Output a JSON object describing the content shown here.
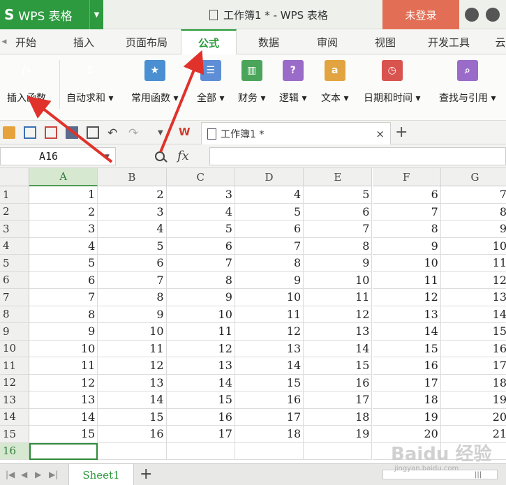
{
  "titlebar": {
    "app_logo": "S",
    "app_name": "WPS 表格",
    "doc_title": "工作簿1 * - WPS 表格",
    "login_label": "未登录"
  },
  "menu": {
    "tabs": [
      "开始",
      "插入",
      "页面布局",
      "公式",
      "数据",
      "审阅",
      "视图",
      "开发工具",
      "云"
    ],
    "active": "公式"
  },
  "ribbon": {
    "buttons": [
      {
        "label": "插入函数",
        "icon": "fx-icon"
      },
      {
        "label": "自动求和 ▾",
        "icon": "sigma-icon"
      },
      {
        "label": "常用函数 ▾",
        "icon": "star-icon"
      },
      {
        "label": "全部 ▾",
        "icon": "list-icon"
      },
      {
        "label": "财务 ▾",
        "icon": "finance-icon"
      },
      {
        "label": "逻辑 ▾",
        "icon": "question-icon"
      },
      {
        "label": "文本 ▾",
        "icon": "text-icon"
      },
      {
        "label": "日期和时间 ▾",
        "icon": "clock-icon"
      },
      {
        "label": "查找与引用 ▾",
        "icon": "lookup-icon"
      }
    ],
    "icon_glyphs": {
      "fx": "fx",
      "sigma": "Σ",
      "star": "★",
      "list": "☰",
      "finance": "▥",
      "question": "?",
      "text": "a",
      "clock": "◷",
      "lookup": "⌕"
    },
    "colors": {
      "star": "#4a8fd1",
      "list": "#5e8fd6",
      "finance": "#4aa55a",
      "question": "#9b6bc9",
      "text": "#e2a440",
      "clock": "#d9534f",
      "lookup": "#9b6bc9"
    }
  },
  "document_tab": {
    "name": "工作簿1 *",
    "close": "×",
    "new_tab": "+"
  },
  "formula_bar": {
    "cell_ref": "A16",
    "fx": "fx",
    "value": ""
  },
  "grid": {
    "columns": [
      "A",
      "B",
      "C",
      "D",
      "E",
      "F",
      "G"
    ],
    "rows": [
      [
        1,
        2,
        3,
        4,
        5,
        6,
        7
      ],
      [
        2,
        3,
        4,
        5,
        6,
        7,
        8
      ],
      [
        3,
        4,
        5,
        6,
        7,
        8,
        9
      ],
      [
        4,
        5,
        6,
        7,
        8,
        9,
        10
      ],
      [
        5,
        6,
        7,
        8,
        9,
        10,
        11
      ],
      [
        6,
        7,
        8,
        9,
        10,
        11,
        12
      ],
      [
        7,
        8,
        9,
        10,
        11,
        12,
        13
      ],
      [
        8,
        9,
        10,
        11,
        12,
        13,
        14
      ],
      [
        9,
        10,
        11,
        12,
        13,
        14,
        15
      ],
      [
        10,
        11,
        12,
        13,
        14,
        15,
        16
      ],
      [
        11,
        12,
        13,
        14,
        15,
        16,
        17
      ],
      [
        12,
        13,
        14,
        15,
        16,
        17,
        18
      ],
      [
        13,
        14,
        15,
        16,
        17,
        18,
        19
      ],
      [
        14,
        15,
        16,
        17,
        18,
        19,
        20
      ],
      [
        15,
        16,
        17,
        18,
        19,
        20,
        21
      ]
    ],
    "active_row": 16,
    "active_col": "A"
  },
  "sheets": {
    "tabs": [
      "Sheet1"
    ],
    "add": "+"
  },
  "watermark": {
    "text": "Baidu 经验",
    "sub": "jingyan.baidu.com"
  },
  "colors": {
    "wps_green": "#2d9a3f",
    "login_red": "#e26f55",
    "arrow_red": "#e0322b"
  }
}
